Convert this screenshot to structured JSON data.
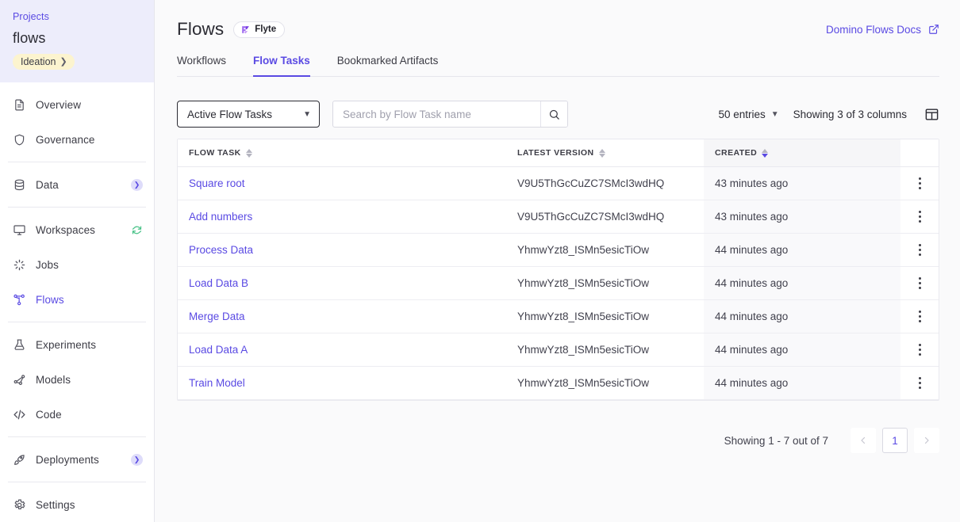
{
  "sidebar": {
    "projects_link": "Projects",
    "project_name": "flows",
    "stage_badge": "Ideation",
    "items": [
      {
        "label": "Overview",
        "icon": "document-icon",
        "active": false,
        "accessory": "none"
      },
      {
        "label": "Governance",
        "icon": "shield-icon",
        "active": false,
        "accessory": "none"
      },
      {
        "label": "Data",
        "icon": "database-icon",
        "active": false,
        "accessory": "chevron"
      },
      {
        "label": "Workspaces",
        "icon": "monitor-icon",
        "active": false,
        "accessory": "sync"
      },
      {
        "label": "Jobs",
        "icon": "spinner-icon",
        "active": false,
        "accessory": "none"
      },
      {
        "label": "Flows",
        "icon": "flow-graph-icon",
        "active": true,
        "accessory": "none"
      },
      {
        "label": "Experiments",
        "icon": "flask-icon",
        "active": false,
        "accessory": "none"
      },
      {
        "label": "Models",
        "icon": "model-icon",
        "active": false,
        "accessory": "none"
      },
      {
        "label": "Code",
        "icon": "code-icon",
        "active": false,
        "accessory": "none"
      },
      {
        "label": "Deployments",
        "icon": "rocket-icon",
        "active": false,
        "accessory": "chevron"
      },
      {
        "label": "Settings",
        "icon": "gear-icon",
        "active": false,
        "accessory": "none"
      }
    ]
  },
  "header": {
    "title": "Flows",
    "badge": "Flyte",
    "docs_link": "Domino Flows Docs",
    "docs_icon": "external-link-icon"
  },
  "tabs": [
    {
      "label": "Workflows",
      "active": false
    },
    {
      "label": "Flow Tasks",
      "active": true
    },
    {
      "label": "Bookmarked Artifacts",
      "active": false
    }
  ],
  "toolbar": {
    "filter_value": "Active Flow Tasks",
    "search_placeholder": "Search by Flow Task name",
    "search_value": "",
    "search_icon": "search-icon",
    "entries_value": "50 entries",
    "columns_text": "Showing 3 of 3 columns",
    "columns_icon": "column-layout-icon"
  },
  "table": {
    "columns": [
      {
        "label": "FLOW TASK",
        "sort": "none"
      },
      {
        "label": "LATEST VERSION",
        "sort": "none"
      },
      {
        "label": "CREATED",
        "sort": "desc"
      },
      {
        "label": "",
        "sort": "none"
      }
    ],
    "rows": [
      {
        "flow_task": "Square root",
        "latest_version": "V9U5ThGcCuZC7SMcI3wdHQ",
        "created": "43 minutes ago"
      },
      {
        "flow_task": "Add numbers",
        "latest_version": "V9U5ThGcCuZC7SMcI3wdHQ",
        "created": "43 minutes ago"
      },
      {
        "flow_task": "Process Data",
        "latest_version": "YhmwYzt8_ISMn5esicTiOw",
        "created": "44 minutes ago"
      },
      {
        "flow_task": "Load Data B",
        "latest_version": "YhmwYzt8_ISMn5esicTiOw",
        "created": "44 minutes ago"
      },
      {
        "flow_task": "Merge Data",
        "latest_version": "YhmwYzt8_ISMn5esicTiOw",
        "created": "44 minutes ago"
      },
      {
        "flow_task": "Load Data A",
        "latest_version": "YhmwYzt8_ISMn5esicTiOw",
        "created": "44 minutes ago"
      },
      {
        "flow_task": "Train Model",
        "latest_version": "YhmwYzt8_ISMn5esicTiOw",
        "created": "44 minutes ago"
      }
    ]
  },
  "pagination": {
    "summary": "Showing 1 - 7 out of 7",
    "prev_icon": "chevron-left-icon",
    "next_icon": "chevron-right-icon",
    "pages": [
      "1"
    ],
    "current_page": "1"
  },
  "colors": {
    "accent": "#5a4ae3",
    "sidebar_header_bg": "#ededfb",
    "stage_badge_bg": "#fcf4cf",
    "sync_green": "#4cc38a",
    "page_bg": "#fafafb"
  }
}
